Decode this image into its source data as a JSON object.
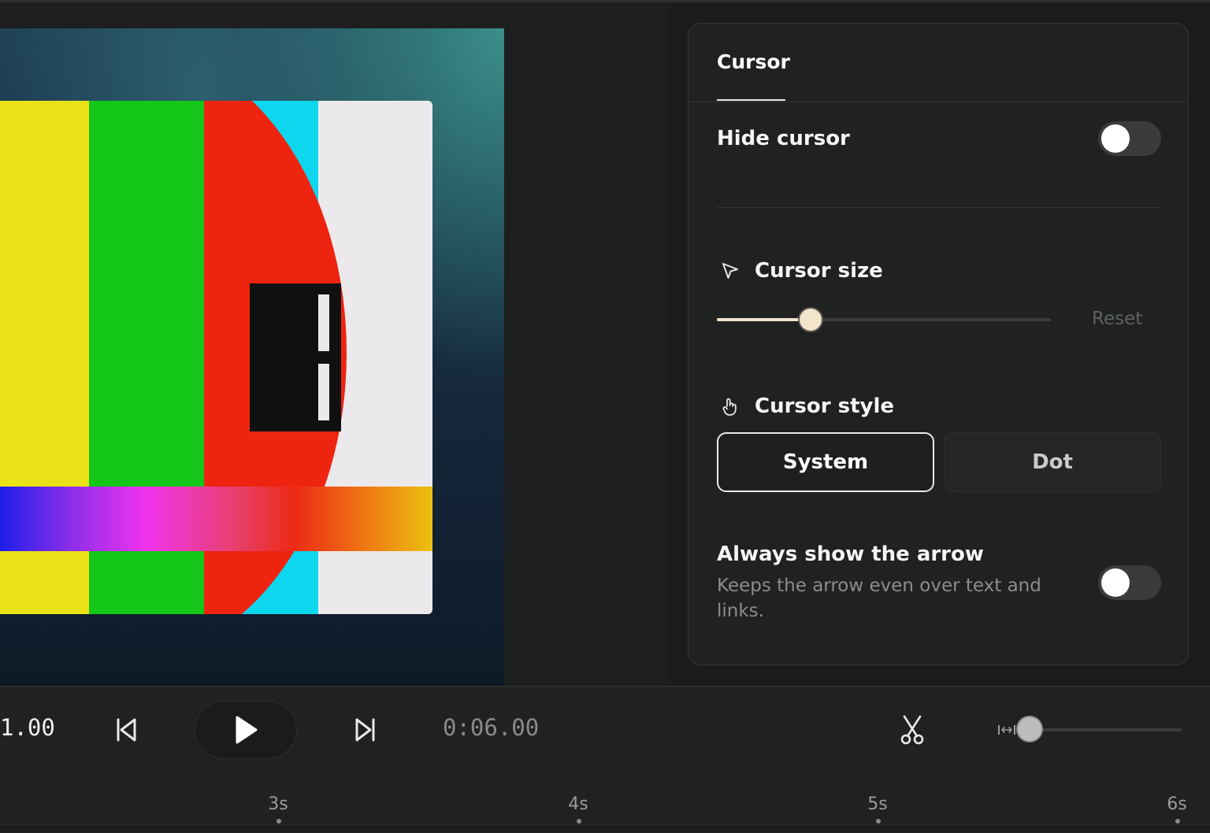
{
  "panel": {
    "tab_label": "Cursor",
    "hide_cursor": {
      "label": "Hide cursor",
      "enabled": false
    },
    "cursor_size": {
      "label": "Cursor size",
      "value_fraction": 0.28,
      "reset_label": "Reset",
      "icon": "pointer-arrow-icon"
    },
    "cursor_style": {
      "label": "Cursor style",
      "icon": "hand-pointer-icon",
      "options": [
        "System",
        "Dot"
      ],
      "selected": "System"
    },
    "always_show_arrow": {
      "label": "Always show the arrow",
      "description": "Keeps the arrow even over text and links.",
      "enabled": false
    }
  },
  "transport": {
    "current_time": "1.00",
    "total_time": "0:06.00",
    "icons": [
      "skip-back-icon",
      "play-icon",
      "skip-forward-icon",
      "scissors-icon",
      "zoom-width-icon"
    ],
    "zoom_fraction": 0.05
  },
  "timeline": {
    "ticks": [
      "3s",
      "4s",
      "5s",
      "6s"
    ]
  },
  "colors": {
    "accent": "#f3e4cc",
    "panel_bg": "#202121",
    "app_bg": "#1e1f1f"
  }
}
